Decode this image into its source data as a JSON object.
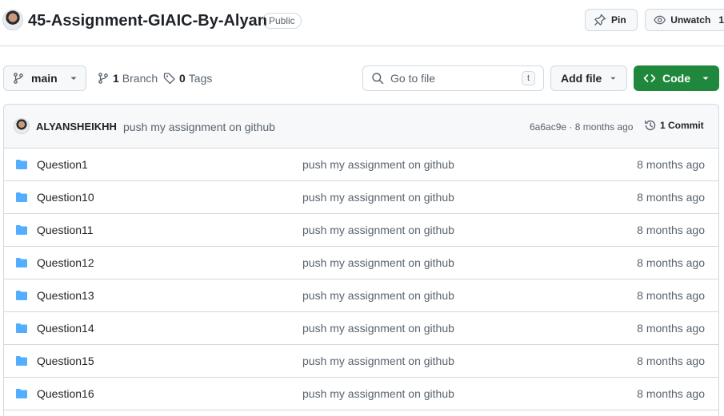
{
  "repo": {
    "name": "45-Assignment-GIAIC-By-Alyan",
    "visibility": "Public",
    "pin_label": "Pin",
    "watch_label": "Unwatch",
    "watch_count": "1"
  },
  "toolbar": {
    "branch": "main",
    "branch_count": "1",
    "branch_word": "Branch",
    "tag_count": "0",
    "tag_word": "Tags",
    "goto_placeholder": "Go to file",
    "goto_shortcut": "t",
    "add_file_label": "Add file",
    "code_label": "Code"
  },
  "latest_commit": {
    "author": "ALYANSHEIKHH",
    "message": "push my assignment on github",
    "meta": "6a6ac9e · 8 months ago",
    "commits_label": "1 Commit"
  },
  "files": [
    {
      "name": "Question1",
      "commit": "push my assignment on github",
      "age": "8 months ago"
    },
    {
      "name": "Question10",
      "commit": "push my assignment on github",
      "age": "8 months ago"
    },
    {
      "name": "Question11",
      "commit": "push my assignment on github",
      "age": "8 months ago"
    },
    {
      "name": "Question12",
      "commit": "push my assignment on github",
      "age": "8 months ago"
    },
    {
      "name": "Question13",
      "commit": "push my assignment on github",
      "age": "8 months ago"
    },
    {
      "name": "Question14",
      "commit": "push my assignment on github",
      "age": "8 months ago"
    },
    {
      "name": "Question15",
      "commit": "push my assignment on github",
      "age": "8 months ago"
    },
    {
      "name": "Question16",
      "commit": "push my assignment on github",
      "age": "8 months ago"
    }
  ],
  "colors": {
    "code_button": "#1f883d",
    "folder": "#54aeff",
    "border": "#d1d9e0",
    "muted_text": "#59636e"
  },
  "icons": [
    "pin-icon",
    "eye-icon",
    "branch-icon",
    "tag-icon",
    "search-icon",
    "code-icon",
    "history-icon",
    "folder-icon",
    "chevron-down-icon"
  ]
}
